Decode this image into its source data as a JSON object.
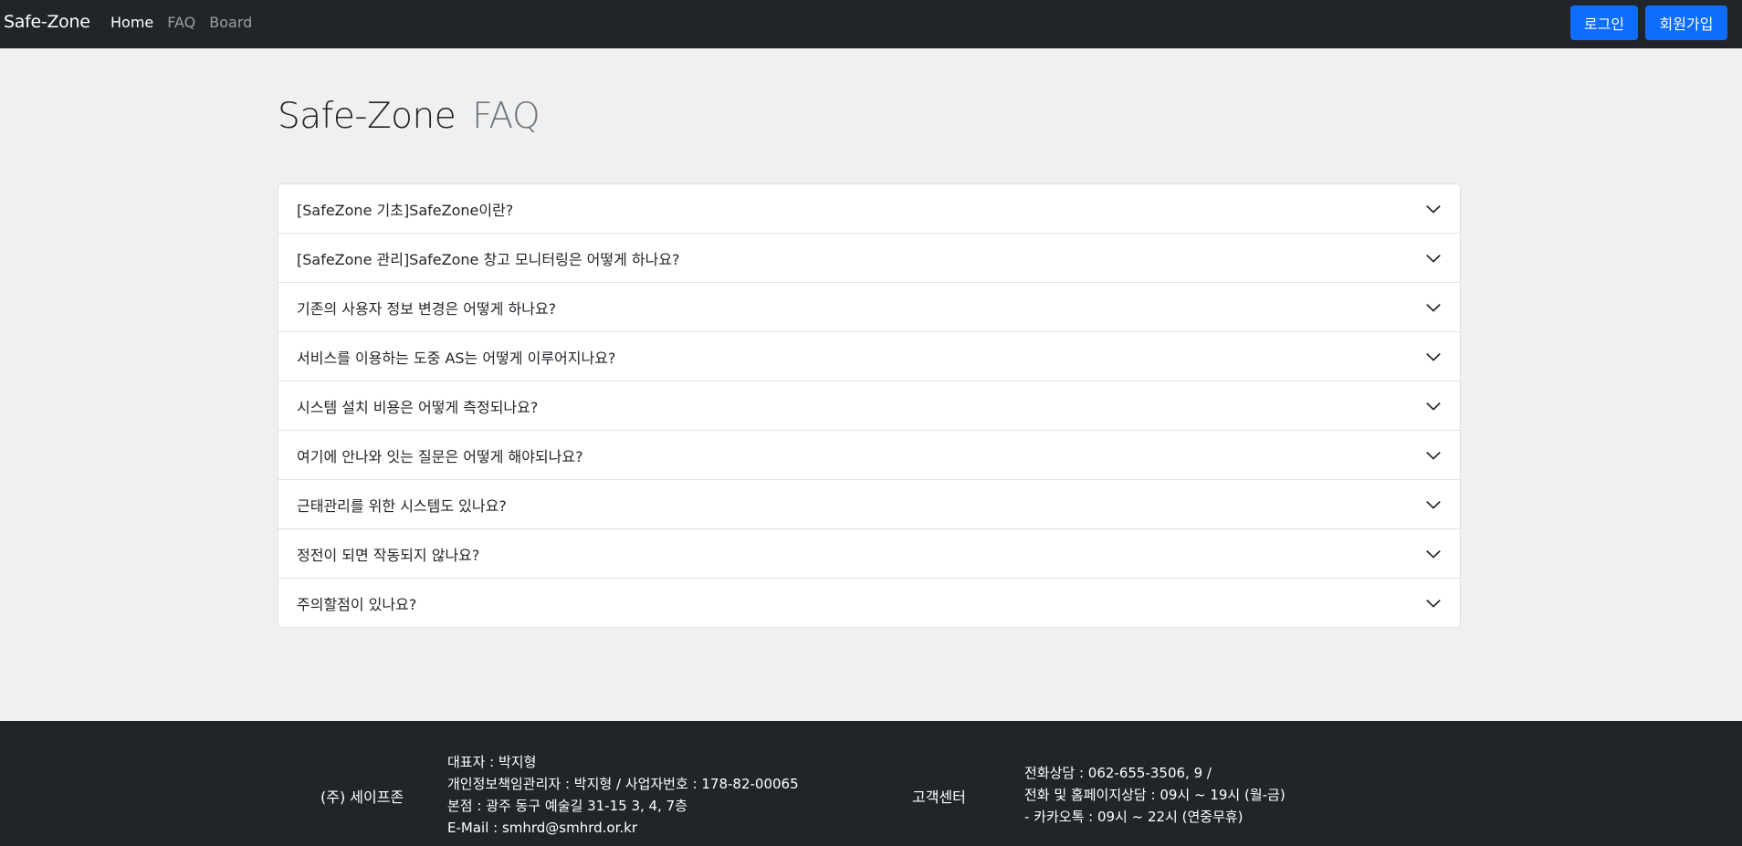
{
  "nav": {
    "brand": "Safe-Zone",
    "links": [
      "Home",
      "FAQ",
      "Board"
    ],
    "login_label": "로그인",
    "signup_label": "회원가입"
  },
  "title": {
    "main": "Safe-Zone",
    "sub": "FAQ"
  },
  "faq": [
    "[SafeZone 기초]SafeZone이란?",
    "[SafeZone 관리]SafeZone 창고 모니터링은 어떻게 하나요?",
    "기존의 사용자 정보 변경은 어떻게 하나요?",
    "서비스를 이용하는 도중 AS는 어떻게 이루어지나요?",
    "시스템 설치 비용은 어떻게 측정되나요?",
    "여기에 안나와 잇는 질문은 어떻게 해야되나요?",
    "근태관리를 위한 시스템도 있나요?",
    "정전이 되면 작동되지 않나요?",
    "주의할점이 있나요?"
  ],
  "footer": {
    "company": "(주) 세이프존",
    "info": [
      "대표자 : 박지형",
      "개인정보책임관리자 : 박지형 / 사업자번호 : 178-82-00065",
      "본점 : 광주 동구 예술길 31-15 3, 4, 7층",
      "E-Mail : smhrd@smhrd.or.kr"
    ],
    "center": "고객센터",
    "contact": [
      "전화상담 : 062-655-3506, 9 /",
      "전화 및 홈페이지상담 : 09시 ~ 19시 (월-금)",
      "- 카카오톡 : 09시 ~ 22시 (연중무휴)"
    ]
  },
  "colors": {
    "navbar_bg": "#212529",
    "primary": "#0d6efd",
    "page_bg": "#f0f0f0",
    "muted": "#6c757d"
  }
}
